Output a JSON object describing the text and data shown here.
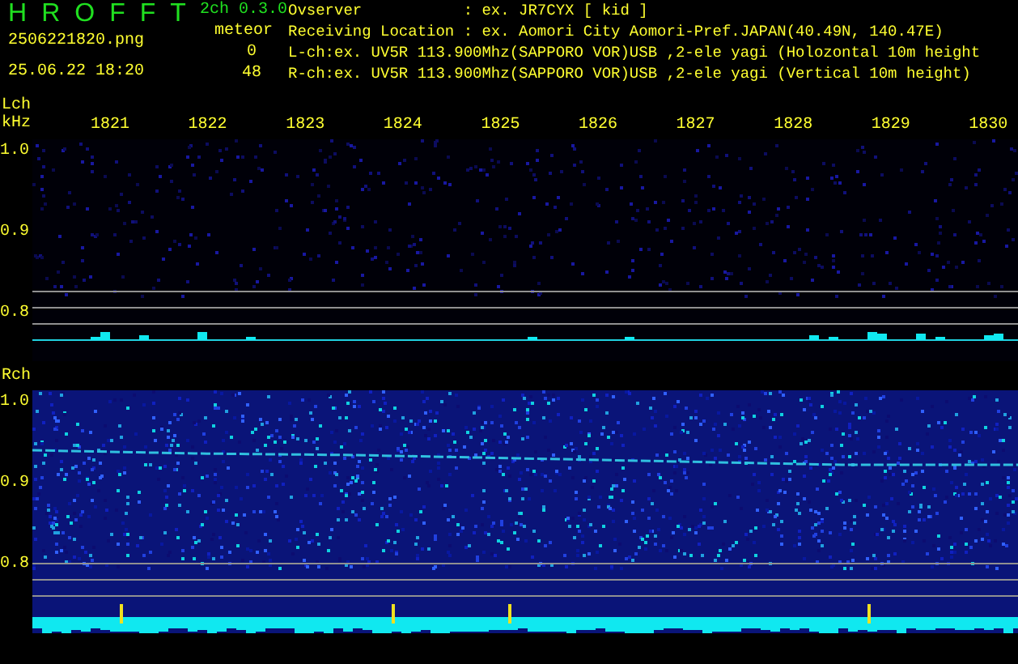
{
  "app": {
    "title_letters": [
      "H",
      "R",
      "O",
      "F",
      "F",
      "T"
    ],
    "version": "2ch 0.3.0"
  },
  "file": {
    "name": "2506221820.png",
    "datetime": "25.06.22 18:20"
  },
  "meteor": {
    "label": "meteor",
    "counts": [
      "0",
      "48"
    ]
  },
  "info_lines": [
    "Ovserver           : ex. JR7CYX [ kid ]",
    "Receiving Location : ex. Aomori City Aomori-Pref.JAPAN(40.49N, 140.47E)",
    "L-ch:ex. UV5R 113.900Mhz(SAPPORO VOR)USB ,2-ele yagi (Holozontal 10m height",
    "R-ch:ex. UV5R 113.900Mhz(SAPPORO VOR)USB ,2-ele yagi (Vertical 10m height)"
  ],
  "time_ticks": [
    "1821",
    "1822",
    "1823",
    "1824",
    "1825",
    "1826",
    "1827",
    "1828",
    "1829",
    "1830"
  ],
  "channels": [
    {
      "name": "Lch",
      "unit": "kHz",
      "yticks": [
        "1.0",
        "0.9",
        "0.8"
      ]
    },
    {
      "name": "Rch",
      "yticks": [
        "1.0",
        "0.9",
        "0.8"
      ]
    }
  ]
}
